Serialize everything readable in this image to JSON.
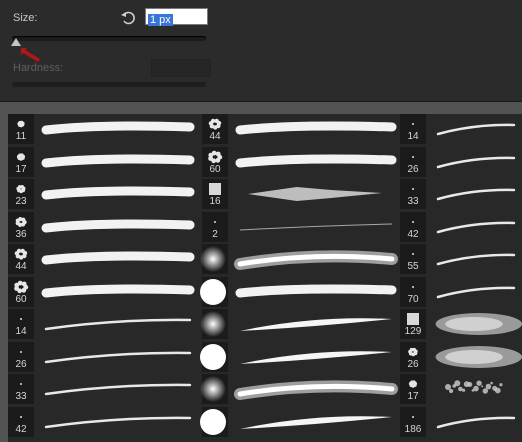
{
  "size_label": "Size:",
  "size_value": "1 px",
  "hardness_label": "Hardness:",
  "columns": [
    [
      "11",
      "17",
      "23",
      "36",
      "44",
      "60",
      "14",
      "26",
      "33",
      "42"
    ],
    [
      "44",
      "60",
      "16",
      "2",
      "",
      "",
      "",
      "",
      "",
      ""
    ],
    [
      "14",
      "26",
      "33",
      "42",
      "55",
      "70",
      "129",
      "26",
      "17",
      "186"
    ]
  ]
}
